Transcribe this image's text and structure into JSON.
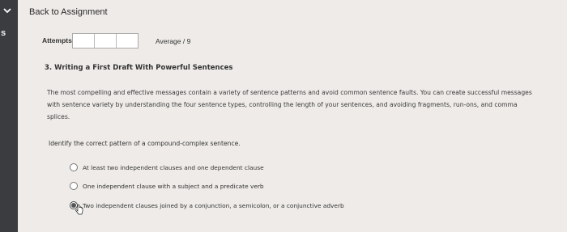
{
  "sidebar": {
    "chevron_icon": "chevron-down-icon",
    "letter": "s"
  },
  "header": {
    "back_link": "Back to Assignment"
  },
  "attempts": {
    "label": "Attempts",
    "average": "Average / 9"
  },
  "question": {
    "title": "3. Writing a First Draft With Powerful Sentences",
    "paragraph": "The most compelling and effective messages contain a variety of sentence patterns and avoid common sentence faults. You can create successful messages with sentence variety by understanding the four sentence types, controlling the length of your sentences, and avoiding fragments, run-ons, and comma splices.",
    "prompt": "Identify the correct pattern of a compound-complex sentence.",
    "options": [
      {
        "label": "At least two independent clauses and one dependent clause",
        "selected": false
      },
      {
        "label": "One independent clause with a subject and a predicate verb",
        "selected": false
      },
      {
        "label": "Two independent clauses joined by a conjunction, a semicolon, or a conjunctive adverb",
        "selected": true
      }
    ]
  }
}
